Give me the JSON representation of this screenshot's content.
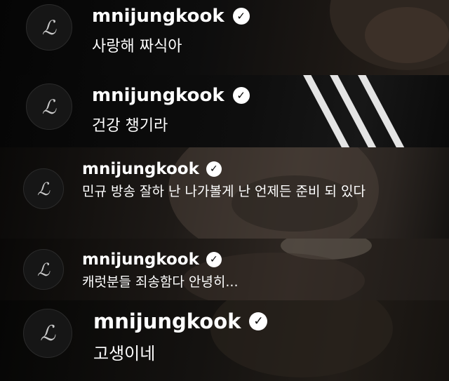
{
  "comments": [
    {
      "username": "mnijungkook",
      "avatar_glyph": "ℒ",
      "verified_icon": "verified-check-icon",
      "message": "사랑해 짜식아"
    },
    {
      "username": "mnijungkook",
      "avatar_glyph": "ℒ",
      "verified_icon": "verified-check-icon",
      "message": "건강 챙기라"
    },
    {
      "username": "mnijungkook",
      "avatar_glyph": "ℒ",
      "verified_icon": "verified-check-icon",
      "message": "민규 방송 잘하 난 나가볼게 난 언제든 준비 되 있다"
    },
    {
      "username": "mnijungkook",
      "avatar_glyph": "ℒ",
      "verified_icon": "verified-check-icon",
      "message": "캐럿분들 죄송함다 안녕히..."
    },
    {
      "username": "mnijungkook",
      "avatar_glyph": "ℒ",
      "verified_icon": "verified-check-icon",
      "message": "고생이네"
    }
  ],
  "colors": {
    "text": "#ffffff",
    "badge_fill": "#ffffff",
    "badge_check": "#000000",
    "avatar_bg": "#161616"
  }
}
